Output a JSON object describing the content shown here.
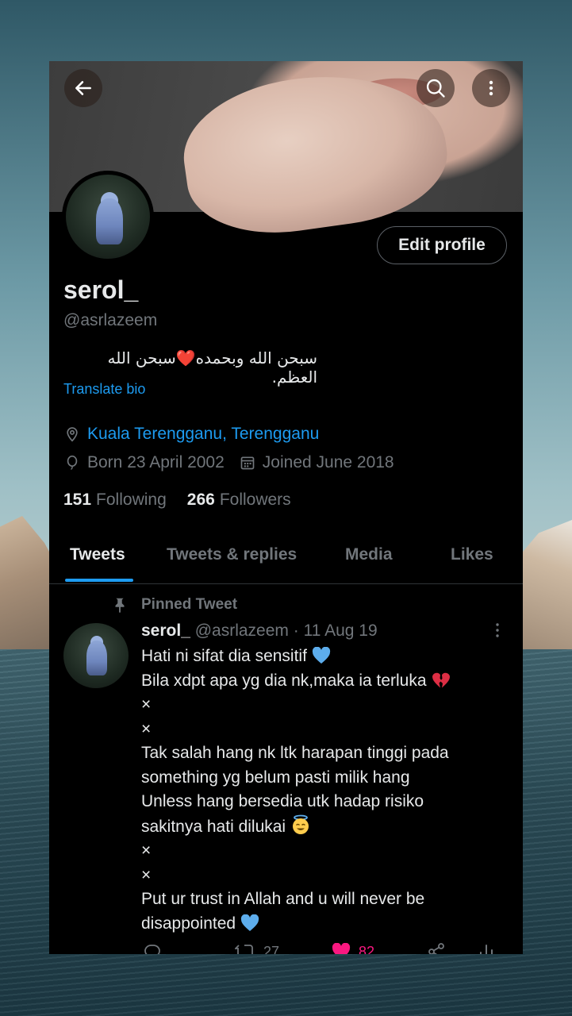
{
  "profile": {
    "name": "serol_",
    "handle": "@asrlazeem",
    "bio": "سبحن الله وبحمده❤️سبحن الله العظم.",
    "translate_label": "Translate bio",
    "location": "Kuala Terengganu, Terengganu",
    "born": "Born 23 April 2002",
    "joined": "Joined June 2018",
    "following_count": "151",
    "following_label": "Following",
    "followers_count": "266",
    "followers_label": "Followers",
    "edit_label": "Edit profile"
  },
  "tabs": [
    {
      "label": "Tweets",
      "active": true
    },
    {
      "label": "Tweets & replies"
    },
    {
      "label": "Media"
    },
    {
      "label": "Likes"
    }
  ],
  "pinned_tweet": {
    "pinned_label": "Pinned Tweet",
    "author_name": "serol_",
    "author_handle": "@asrlazeem",
    "separator": "·",
    "date": "11 Aug 19",
    "lines": [
      "Hati ni sifat dia sensitif",
      "Bila xdpt apa yg dia nk,maka ia terluka",
      "×",
      "×",
      "Tak salah hang nk ltk harapan tinggi pada",
      "something yg belum pasti milik hang",
      "Unless hang bersedia utk hadap risiko",
      "sakitnya hati dilukai",
      "×",
      "×",
      "Put ur trust in Allah and u will never be",
      "disappointed"
    ],
    "retweet_count": "27",
    "like_count": "82"
  },
  "icons": {
    "back": "arrow-left-icon",
    "search": "search-icon",
    "more": "more-vertical-icon",
    "location": "location-pin-icon",
    "birthday": "balloon-icon",
    "joined": "calendar-icon",
    "pin": "pin-icon"
  },
  "colors": {
    "accent": "#1d9bf0",
    "background": "#000000",
    "text_primary": "#e7e9ea",
    "text_secondary": "#71767b",
    "like": "#f91880"
  }
}
